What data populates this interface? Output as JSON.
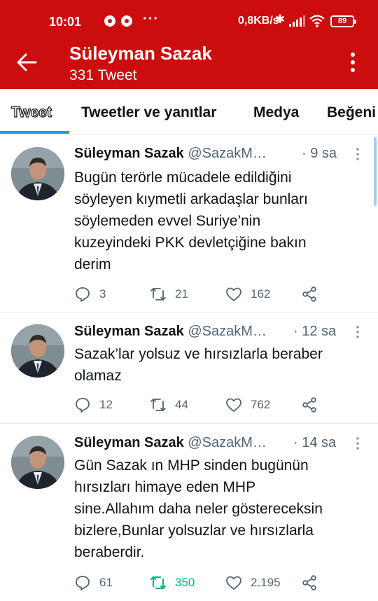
{
  "status_bar": {
    "time": "10:01",
    "network_speed": "0,8KB/s",
    "battery": "89",
    "overflow": "···"
  },
  "header": {
    "title": "Süleyman Sazak",
    "subtitle": "331 Tweet",
    "background_color": "#cc0d0d"
  },
  "tabs": [
    {
      "label": "Tweet",
      "active": true
    },
    {
      "label": "Tweetler ve yanıtlar",
      "active": false
    },
    {
      "label": "Medya",
      "active": false
    },
    {
      "label": "Beğeni",
      "active": false
    }
  ],
  "tweets": [
    {
      "name": "Süleyman Sazak",
      "handle": "@SazakM…",
      "time": "· 9 sa",
      "lines": [
        "Bugün terörle mücadele edildiğini",
        "söyleyen kıymetli arkadaşlar bunları",
        "söylemeden evvel Suriye’nin",
        "kuzeyindeki PKK devletçiğine bakın",
        "derim"
      ],
      "replies": "3",
      "retweets": "21",
      "likes": "162",
      "retweeted": false
    },
    {
      "name": "Süleyman Sazak",
      "handle": "@SazakM…",
      "time": "· 12 sa",
      "lines": [
        "Sazak’lar yolsuz ve hırsızlarla beraber",
        "olamaz"
      ],
      "replies": "12",
      "retweets": "44",
      "likes": "762",
      "retweeted": false
    },
    {
      "name": "Süleyman Sazak",
      "handle": "@SazakM…",
      "time": "· 14 sa",
      "lines": [
        "Gün Sazak ın MHP sinden bugünün",
        "hırsızları himaye eden MHP",
        "sine.Allahım daha neler göstereceksin",
        "bizlere,Bunlar yolsuzlar ve hırsızlarla",
        "beraberdir."
      ],
      "replies": "61",
      "retweets": "350",
      "likes": "2.195",
      "retweeted": true
    }
  ],
  "icons": [
    "back-arrow-icon",
    "more-vertical-icon",
    "reply-icon",
    "retweet-icon",
    "like-icon",
    "share-icon",
    "caret-icon"
  ],
  "colors": {
    "accent": "#1d9bf0",
    "retweet_active": "#00ba7c",
    "secondary_text": "#536471"
  }
}
